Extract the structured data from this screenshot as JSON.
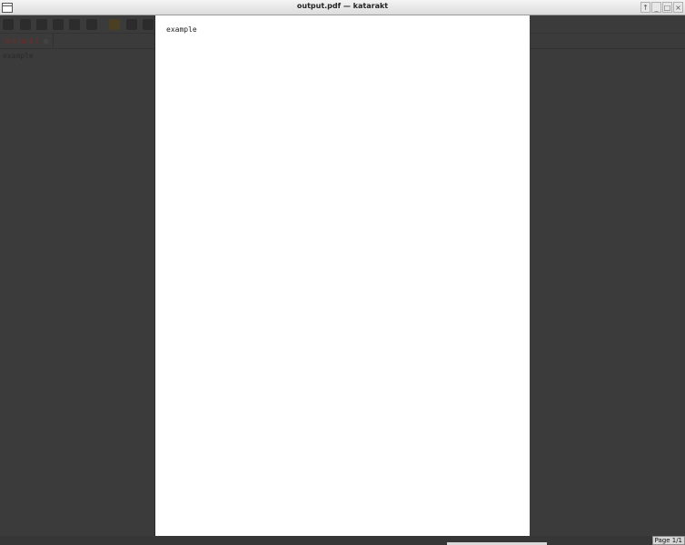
{
  "window": {
    "title": "output.pdf — katarakt",
    "buttons": {
      "up": "↑",
      "minimize": "_",
      "maximize": "□",
      "close": "×"
    }
  },
  "editor": {
    "tab": {
      "label": "Untitled 1",
      "close": "⊗"
    },
    "content": "example"
  },
  "viewer": {
    "page_text": "example",
    "page_indicator": "Page 1/1"
  }
}
